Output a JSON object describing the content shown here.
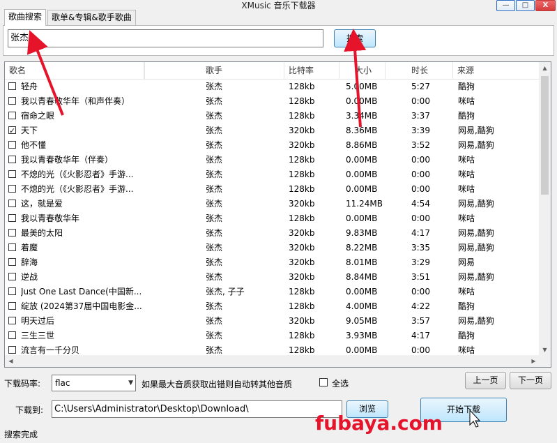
{
  "window": {
    "title": "XMusic 音乐下载器",
    "min": "—",
    "max": "□",
    "close": "X"
  },
  "tabs": [
    {
      "label": "歌曲搜索",
      "active": true
    },
    {
      "label": "歌单&专辑&歌手歌曲",
      "active": false
    }
  ],
  "search": {
    "value": "张杰",
    "button": "搜索"
  },
  "columns": [
    "歌名",
    "歌手",
    "比特率",
    "大小",
    "时长",
    "来源"
  ],
  "rows": [
    {
      "checked": false,
      "name": "轻舟",
      "artist": "张杰",
      "bitrate": "128kb",
      "size": "5.00MB",
      "duration": "5:27",
      "source": "酷狗"
    },
    {
      "checked": false,
      "name": "我以青春敬华年（和声伴奏）",
      "artist": "张杰",
      "bitrate": "128kb",
      "size": "0.00MB",
      "duration": "0:00",
      "source": "咪咕"
    },
    {
      "checked": false,
      "name": "宿命之眼",
      "artist": "张杰",
      "bitrate": "128kb",
      "size": "3.34MB",
      "duration": "3:37",
      "source": "酷狗"
    },
    {
      "checked": true,
      "name": "天下",
      "artist": "张杰",
      "bitrate": "320kb",
      "size": "8.36MB",
      "duration": "3:39",
      "source": "网易,酷狗"
    },
    {
      "checked": false,
      "name": "他不懂",
      "artist": "张杰",
      "bitrate": "320kb",
      "size": "8.86MB",
      "duration": "3:52",
      "source": "网易,酷狗"
    },
    {
      "checked": false,
      "name": "我以青春敬华年（伴奏）",
      "artist": "张杰",
      "bitrate": "128kb",
      "size": "0.00MB",
      "duration": "0:00",
      "source": "咪咕"
    },
    {
      "checked": false,
      "name": "不熄的光（《火影忍者》手游...",
      "artist": "张杰",
      "bitrate": "128kb",
      "size": "0.00MB",
      "duration": "0:00",
      "source": "咪咕"
    },
    {
      "checked": false,
      "name": "不熄的光（《火影忍者》手游...",
      "artist": "张杰",
      "bitrate": "128kb",
      "size": "0.00MB",
      "duration": "0:00",
      "source": "咪咕"
    },
    {
      "checked": false,
      "name": "这，就是爱",
      "artist": "张杰",
      "bitrate": "320kb",
      "size": "11.24MB",
      "duration": "4:54",
      "source": "网易,酷狗"
    },
    {
      "checked": false,
      "name": "我以青春敬华年",
      "artist": "张杰",
      "bitrate": "128kb",
      "size": "0.00MB",
      "duration": "0:00",
      "source": "咪咕"
    },
    {
      "checked": false,
      "name": "最美的太阳",
      "artist": "张杰",
      "bitrate": "320kb",
      "size": "9.83MB",
      "duration": "4:17",
      "source": "网易,酷狗"
    },
    {
      "checked": false,
      "name": "着魔",
      "artist": "张杰",
      "bitrate": "320kb",
      "size": "8.22MB",
      "duration": "3:35",
      "source": "网易,酷狗"
    },
    {
      "checked": false,
      "name": "辞海",
      "artist": "张杰",
      "bitrate": "320kb",
      "size": "8.01MB",
      "duration": "3:29",
      "source": "网易"
    },
    {
      "checked": false,
      "name": "逆战",
      "artist": "张杰",
      "bitrate": "320kb",
      "size": "8.84MB",
      "duration": "3:51",
      "source": "网易,酷狗"
    },
    {
      "checked": false,
      "name": "Just One Last Dance(中国新...",
      "artist": "张杰, 子子",
      "bitrate": "128kb",
      "size": "0.00MB",
      "duration": "0:00",
      "source": "咪咕"
    },
    {
      "checked": false,
      "name": "绽放 (2024第37届中国电影金...",
      "artist": "张杰",
      "bitrate": "128kb",
      "size": "4.00MB",
      "duration": "4:22",
      "source": "酷狗"
    },
    {
      "checked": false,
      "name": "明天过后",
      "artist": "张杰",
      "bitrate": "320kb",
      "size": "9.05MB",
      "duration": "3:57",
      "source": "网易,酷狗"
    },
    {
      "checked": false,
      "name": "三生三世",
      "artist": "张杰",
      "bitrate": "128kb",
      "size": "3.93MB",
      "duration": "4:17",
      "source": "酷狗"
    },
    {
      "checked": false,
      "name": "流言有一千分贝",
      "artist": "张杰",
      "bitrate": "128kb",
      "size": "0.00MB",
      "duration": "0:00",
      "source": "咪咕"
    }
  ],
  "controls": {
    "bitrate_label": "下载码率:",
    "bitrate_value": "flac",
    "fallback_note": "如果最大音质获取出错则自动转其他音质",
    "select_all": "全选",
    "prev_page": "上一页",
    "next_page": "下一页",
    "download_to_label": "下载到:",
    "download_path": "C:\\Users\\Administrator\\Desktop\\Download\\",
    "browse": "浏览",
    "start_download": "开始下载"
  },
  "status": "搜索完成",
  "watermark": "fubaya.com",
  "colors": {
    "annotation_arrow": "#e5142b",
    "accent_button": "#bee6fd"
  }
}
